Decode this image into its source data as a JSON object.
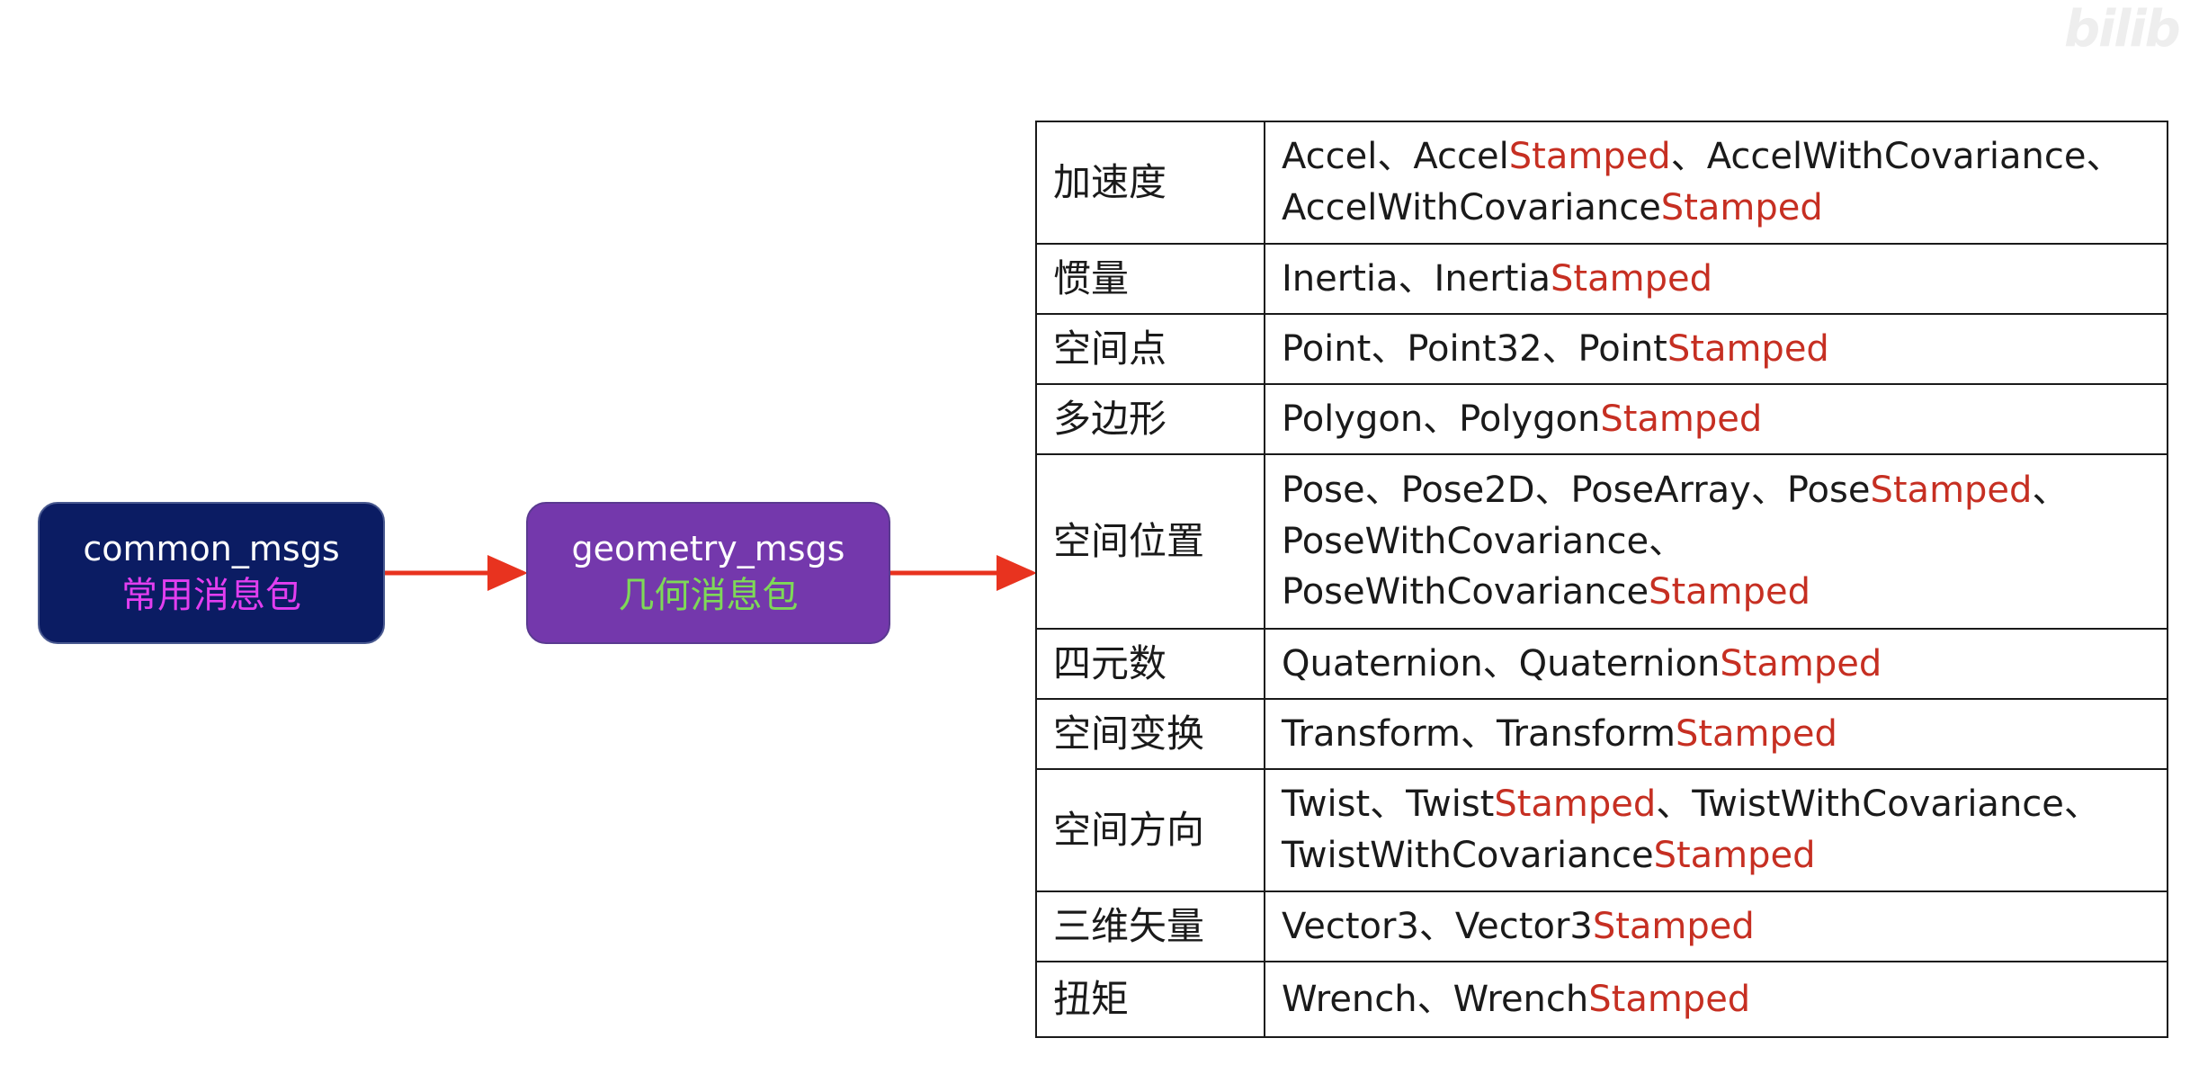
{
  "watermark": "bilib",
  "nodes": {
    "common": {
      "en": "common_msgs",
      "zh": "常用消息包"
    },
    "geometry": {
      "en": "geometry_msgs",
      "zh": "几何消息包"
    }
  },
  "colors": {
    "common_box": "#0b1c63",
    "geometry_box": "#7438ac",
    "common_zh": "#e23ef0",
    "geometry_zh": "#7ed957",
    "arrow": "#e8331f",
    "stamped": "#c62f22"
  },
  "rows": [
    {
      "cat": "加速度",
      "types": [
        {
          "base": "Accel",
          "sep": "、"
        },
        {
          "base": "Accel",
          "suffix": "Stamped",
          "sep": "、"
        },
        {
          "base": "AccelWithCovariance",
          "sep": "、"
        },
        {
          "base": "AccelWithCovariance",
          "suffix": "Stamped"
        }
      ]
    },
    {
      "cat": "惯量",
      "types": [
        {
          "base": "Inertia",
          "sep": "、"
        },
        {
          "base": "Inertia",
          "suffix": "Stamped"
        }
      ]
    },
    {
      "cat": "空间点",
      "types": [
        {
          "base": "Point",
          "sep": "、"
        },
        {
          "base": "Point32",
          "sep": "、"
        },
        {
          "base": "Point",
          "suffix": "Stamped"
        }
      ]
    },
    {
      "cat": "多边形",
      "types": [
        {
          "base": "Polygon",
          "sep": "、"
        },
        {
          "base": "Polygon",
          "suffix": "Stamped"
        }
      ]
    },
    {
      "cat": "空间位置",
      "types": [
        {
          "base": "Pose",
          "sep": "、"
        },
        {
          "base": "Pose2D",
          "sep": "、"
        },
        {
          "base": "PoseArray",
          "sep": "、"
        },
        {
          "base": "Pose",
          "suffix": "Stamped",
          "sep": "、"
        },
        {
          "base": "PoseWithCovariance",
          "sep": "、"
        },
        {
          "base": "PoseWithCovariance",
          "suffix": "Stamped"
        }
      ]
    },
    {
      "cat": "四元数",
      "types": [
        {
          "base": "Quaternion",
          "sep": "、"
        },
        {
          "base": "Quaternion",
          "suffix": "Stamped"
        }
      ]
    },
    {
      "cat": "空间变换",
      "types": [
        {
          "base": "Transform",
          "sep": "、"
        },
        {
          "base": "Transform",
          "suffix": "Stamped"
        }
      ]
    },
    {
      "cat": "空间方向",
      "types": [
        {
          "base": "Twist",
          "sep": "、"
        },
        {
          "base": "Twist",
          "suffix": "Stamped",
          "sep": "、"
        },
        {
          "base": "TwistWithCovariance",
          "sep": "、"
        },
        {
          "base": "TwistWithCovariance",
          "suffix": "Stamped"
        }
      ]
    },
    {
      "cat": "三维矢量",
      "types": [
        {
          "base": "Vector3",
          "sep": "、"
        },
        {
          "base": "Vector3",
          "suffix": "Stamped"
        }
      ]
    },
    {
      "cat": "扭矩",
      "types": [
        {
          "base": "Wrench",
          "sep": "、"
        },
        {
          "base": "Wrench",
          "suffix": "Stamped"
        }
      ]
    }
  ]
}
